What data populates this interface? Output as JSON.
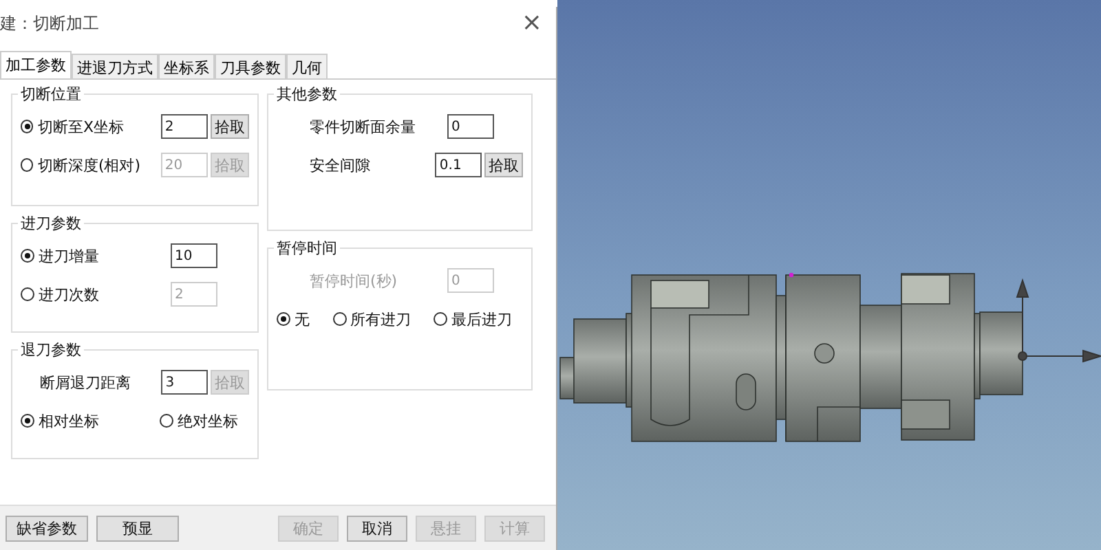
{
  "dialog": {
    "title": "建：切断加工",
    "close": "×"
  },
  "tabs": [
    {
      "label": "加工参数",
      "selected": true
    },
    {
      "label": "进退刀方式",
      "selected": false
    },
    {
      "label": "坐标系",
      "selected": false
    },
    {
      "label": "刀具参数",
      "selected": false
    },
    {
      "label": "几何",
      "selected": false
    }
  ],
  "left_groups": [
    {
      "title": "切断位置",
      "rows": [
        {
          "kind": "radio",
          "label": "切断至X坐标",
          "selected": true,
          "value": "2",
          "disabled": false,
          "button": "拾取",
          "button_disabled": false
        },
        {
          "kind": "radio",
          "label": "切断深度(相对)",
          "selected": false,
          "value": "20",
          "disabled": true,
          "button": "拾取",
          "button_disabled": true
        }
      ]
    },
    {
      "title": "进刀参数",
      "rows": [
        {
          "kind": "radio",
          "label": "进刀增量",
          "selected": true,
          "value": "10",
          "disabled": false
        },
        {
          "kind": "radio",
          "label": "进刀次数",
          "selected": false,
          "value": "2",
          "disabled": true
        }
      ]
    },
    {
      "title": "退刀参数",
      "rows": [
        {
          "kind": "field",
          "label": "断屑退刀距离",
          "value": "3",
          "disabled": false,
          "button": "拾取",
          "button_disabled": true
        },
        {
          "kind": "radios",
          "options": [
            {
              "label": "相对坐标",
              "selected": true
            },
            {
              "label": "绝对坐标",
              "selected": false
            }
          ]
        }
      ]
    }
  ],
  "right_groups": [
    {
      "title": "其他参数",
      "rows": [
        {
          "kind": "field",
          "label": "零件切断面余量",
          "value": "0",
          "disabled": false
        },
        {
          "kind": "field",
          "label": "安全间隙",
          "value": "0.1",
          "disabled": false,
          "button": "拾取",
          "button_disabled": false
        }
      ]
    },
    {
      "title": "暂停时间",
      "rows": [
        {
          "kind": "field",
          "label": "暂停时间(秒)",
          "value": "0",
          "disabled": true
        },
        {
          "kind": "radios",
          "options": [
            {
              "label": "无",
              "selected": true
            },
            {
              "label": "所有进刀",
              "selected": false
            },
            {
              "label": "最后进刀",
              "selected": false
            }
          ]
        }
      ]
    }
  ],
  "buttons_left": [
    {
      "label": "缺省参数",
      "disabled": false
    },
    {
      "label": "预显",
      "disabled": false
    }
  ],
  "buttons_right": [
    {
      "label": "确定",
      "disabled": true
    },
    {
      "label": "取消",
      "disabled": false
    },
    {
      "label": "悬挂",
      "disabled": true
    },
    {
      "label": "计算",
      "disabled": true
    }
  ]
}
